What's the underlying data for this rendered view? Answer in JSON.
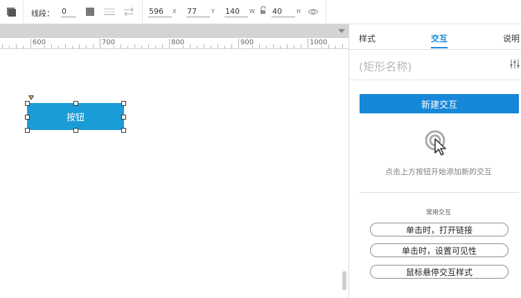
{
  "toolbar": {
    "segment_label": "线段：",
    "segment_value": "0",
    "x_value": "596",
    "x_axis": "X",
    "y_value": "77",
    "y_axis": "Y",
    "w_value": "140",
    "w_axis": "W",
    "h_value": "40",
    "h_axis": "H"
  },
  "ruler": {
    "labels": [
      "600",
      "700",
      "800",
      "900",
      "1000"
    ]
  },
  "canvas": {
    "widget_label": "按钮",
    "widget_color": "#1a9cd6"
  },
  "panel": {
    "tabs": [
      "样式",
      "交互",
      "说明"
    ],
    "active_tab": "交互",
    "shape_name_placeholder": "(矩形名称)",
    "new_interaction_button": "新建交互",
    "hint_text": "点击上方按钮开始添加新的交互",
    "common_title": "常用交互",
    "common_interactions": [
      "单击时，打开链接",
      "单击时，设置可见性",
      "鼠标悬停交互样式"
    ],
    "accent_color": "#1788d8"
  }
}
